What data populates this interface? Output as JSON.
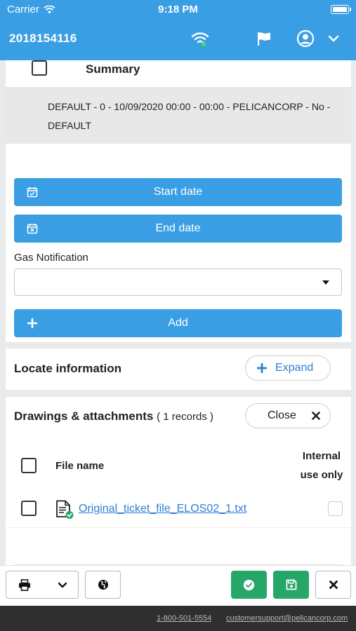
{
  "status_bar": {
    "carrier": "Carrier",
    "time": "9:18 PM"
  },
  "app_bar": {
    "ticket_id": "2018154116",
    "icons": [
      "wifi-connected-icon",
      "flag-icon",
      "user-account-icon",
      "chevron-down-icon"
    ]
  },
  "summary": {
    "label": "Summary",
    "text": "DEFAULT - 0 - 10/09/2020 00:00 - 00:00 - PELICANCORP - No - DEFAULT"
  },
  "dates": {
    "start_label": "Start date",
    "end_label": "End date"
  },
  "gas_notification": {
    "label": "Gas Notification",
    "value": ""
  },
  "add_button": {
    "label": "Add",
    "icon": "plus-icon"
  },
  "locate": {
    "title": "Locate information",
    "expand_label": "Expand"
  },
  "attachments": {
    "title": "Drawings & attachments",
    "count": "( 1 records )",
    "close_label": "Close",
    "columns": {
      "file_name": "File name",
      "internal_line1": "Internal",
      "internal_line2": "use only"
    },
    "rows": [
      {
        "file_name": "Original_ticket_file_ELOS02_1.txt",
        "internal_use_only": false
      }
    ]
  },
  "toolbar": {
    "icons": [
      "print-icon",
      "chevron-down-icon",
      "globe-icon",
      "check-icon",
      "save-icon",
      "close-icon"
    ]
  },
  "footer": {
    "phone": "1-800-501-5554",
    "email": "customersupport@pelicancorp.com"
  },
  "colors": {
    "primary": "#3a9ee4",
    "success": "#26a769",
    "link": "#2c7fd2",
    "footer_bg": "#2f2f2f"
  }
}
